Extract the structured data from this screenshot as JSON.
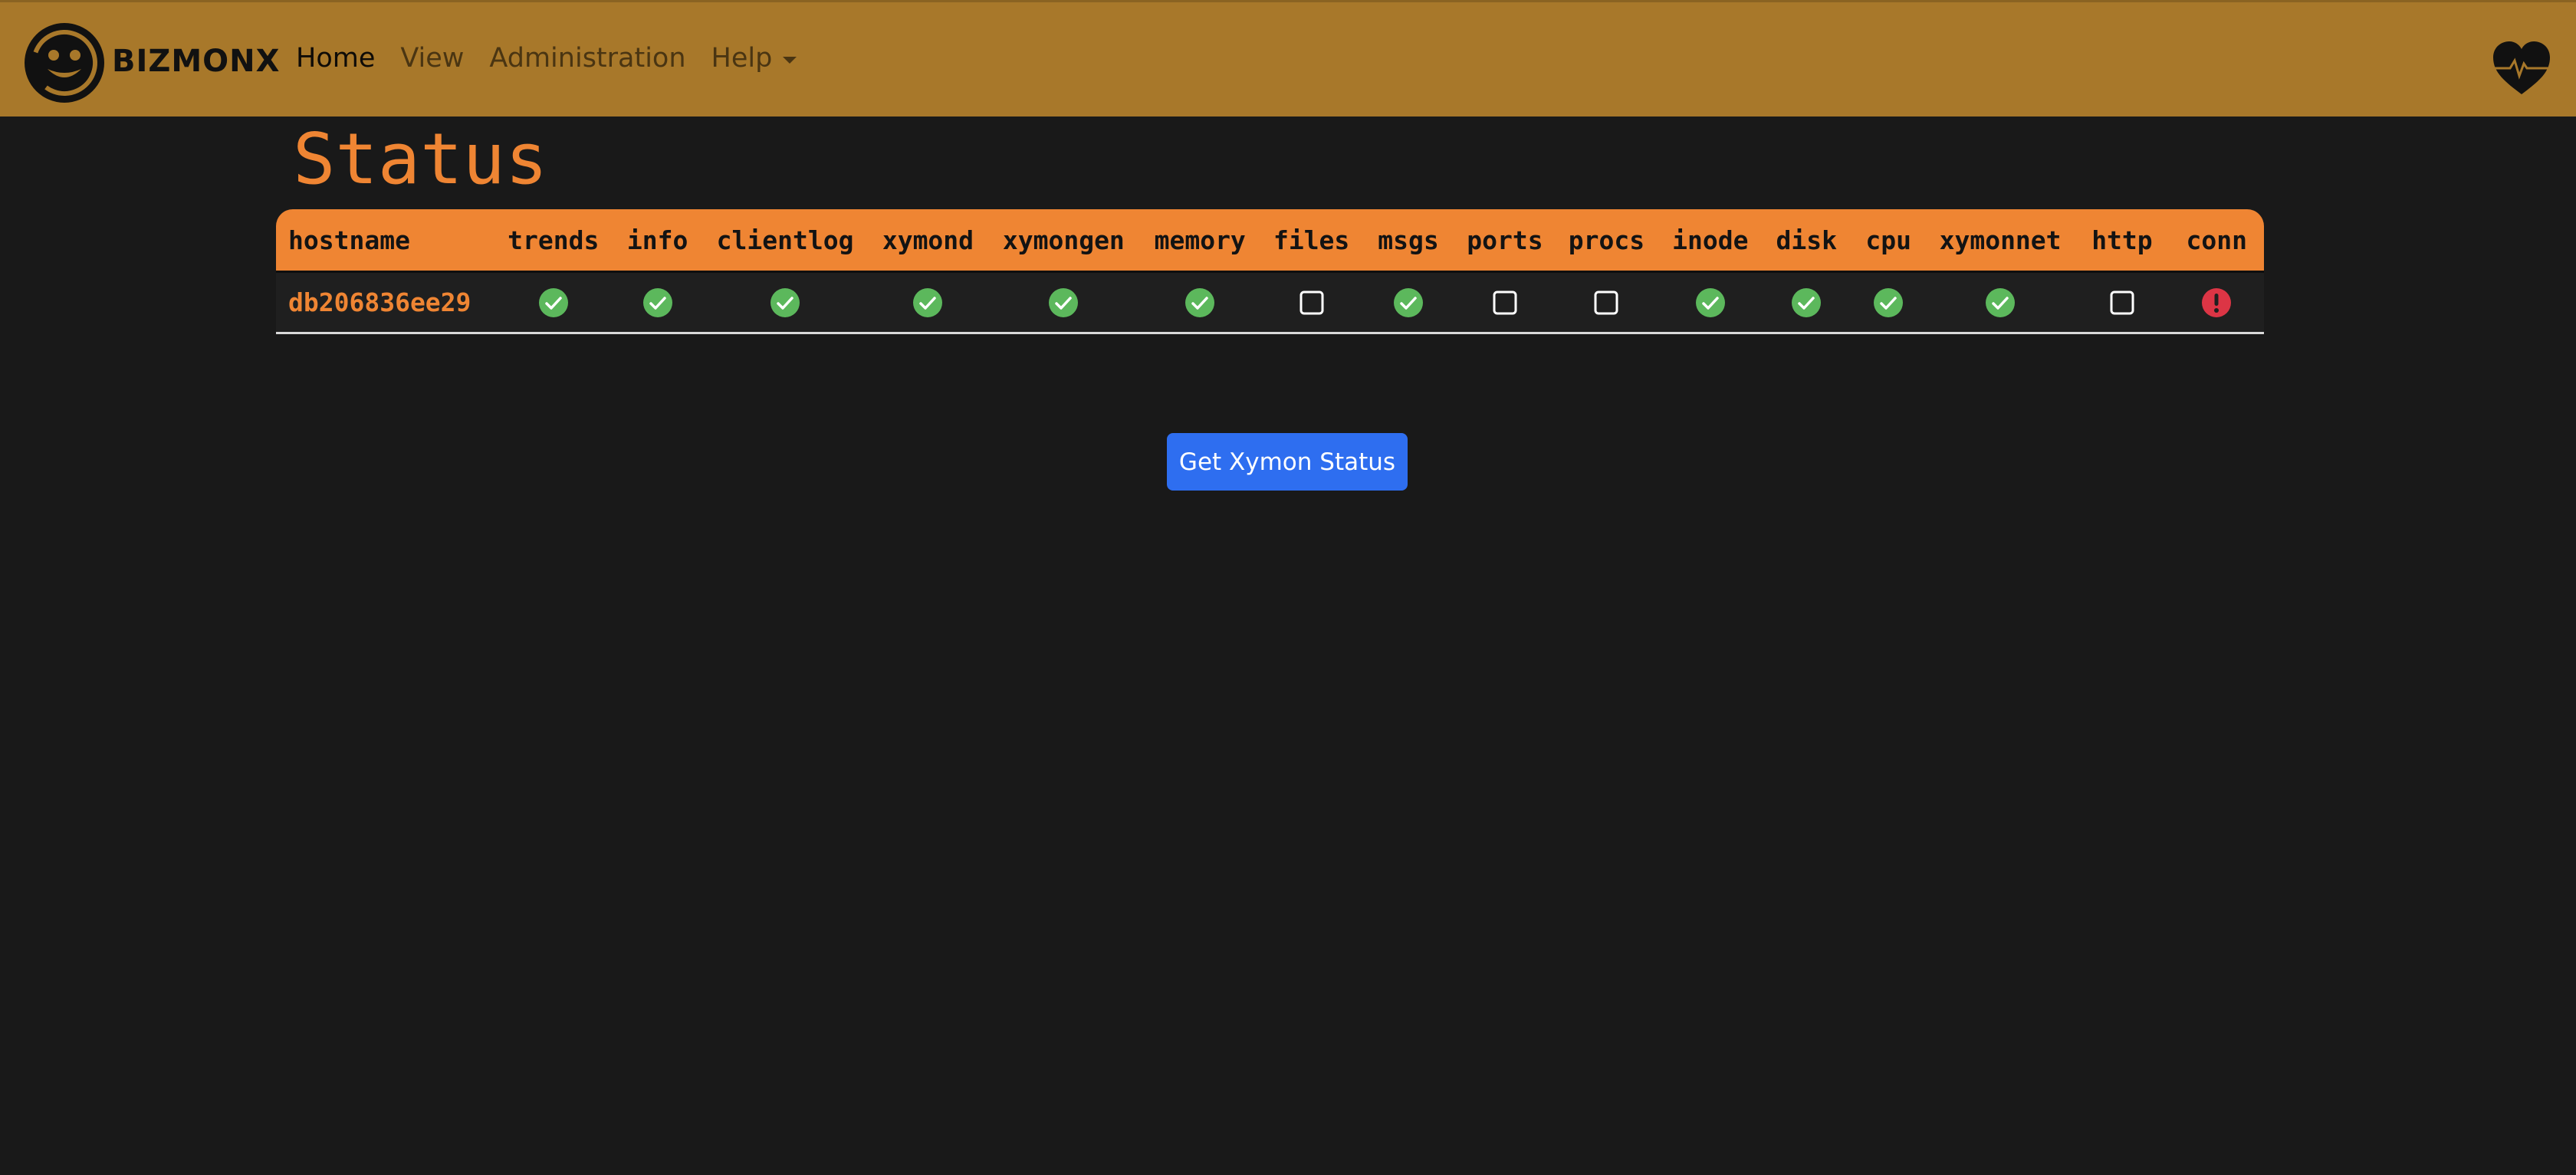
{
  "navbar": {
    "brand": "BIZMONX",
    "links": [
      {
        "label": "Home",
        "active": true
      },
      {
        "label": "View",
        "active": false
      },
      {
        "label": "Administration",
        "active": false
      },
      {
        "label": "Help",
        "active": false,
        "dropdown": true
      }
    ],
    "right_icon": "heart-pulse-icon",
    "bg_color": "#a8782a"
  },
  "page": {
    "title": "Status",
    "accent_color": "#ef8533",
    "background": "#191919"
  },
  "status_table": {
    "columns": [
      "hostname",
      "trends",
      "info",
      "clientlog",
      "xymond",
      "xymongen",
      "memory",
      "files",
      "msgs",
      "ports",
      "procs",
      "inode",
      "disk",
      "cpu",
      "xymonnet",
      "http",
      "conn"
    ],
    "rows": [
      {
        "hostname": "db206836ee29",
        "status": [
          "ok",
          "ok",
          "ok",
          "ok",
          "ok",
          "ok",
          "none",
          "ok",
          "none",
          "none",
          "ok",
          "ok",
          "ok",
          "ok",
          "none",
          "error"
        ]
      }
    ],
    "status_colors": {
      "ok": "#5cb85c",
      "error": "#dc3545",
      "none": "#ffffff"
    }
  },
  "actions": {
    "get_status_label": "Get Xymon Status",
    "button_color": "#2e6ef0"
  }
}
